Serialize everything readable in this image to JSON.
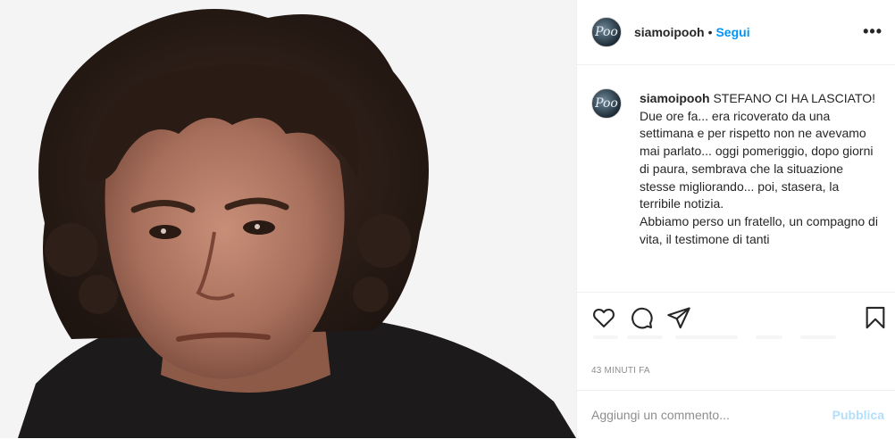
{
  "post": {
    "username": "siamoipooh",
    "separator": "•",
    "follow_label": "Segui",
    "more_label": "•••",
    "avatar_icon": "pooh-logo-icon",
    "caption_title": "STEFANO CI HA LASCIATO!",
    "caption_lines": [
      "Due ore fa... era ricoverato da una settimana e per rispetto non ne avevamo mai parlato... oggi pomeriggio, dopo giorni di paura, sembrava che la situazione stesse migliorando... poi, stasera, la terribile notizia.",
      "Abbiamo perso un fratello, un compagno di vita, il testimone di tanti"
    ],
    "timestamp": "43 MINUTI FA",
    "comment_placeholder": "Aggiungi un commento...",
    "publish_label": "Pubblica"
  },
  "icons": {
    "like": "heart-icon",
    "comment": "comment-bubble-icon",
    "share": "paper-plane-icon",
    "save": "bookmark-icon"
  },
  "colors": {
    "link_blue": "#0095f6",
    "publish_disabled": "#b2dffc",
    "muted": "#8e8e8e",
    "text": "#262626"
  }
}
